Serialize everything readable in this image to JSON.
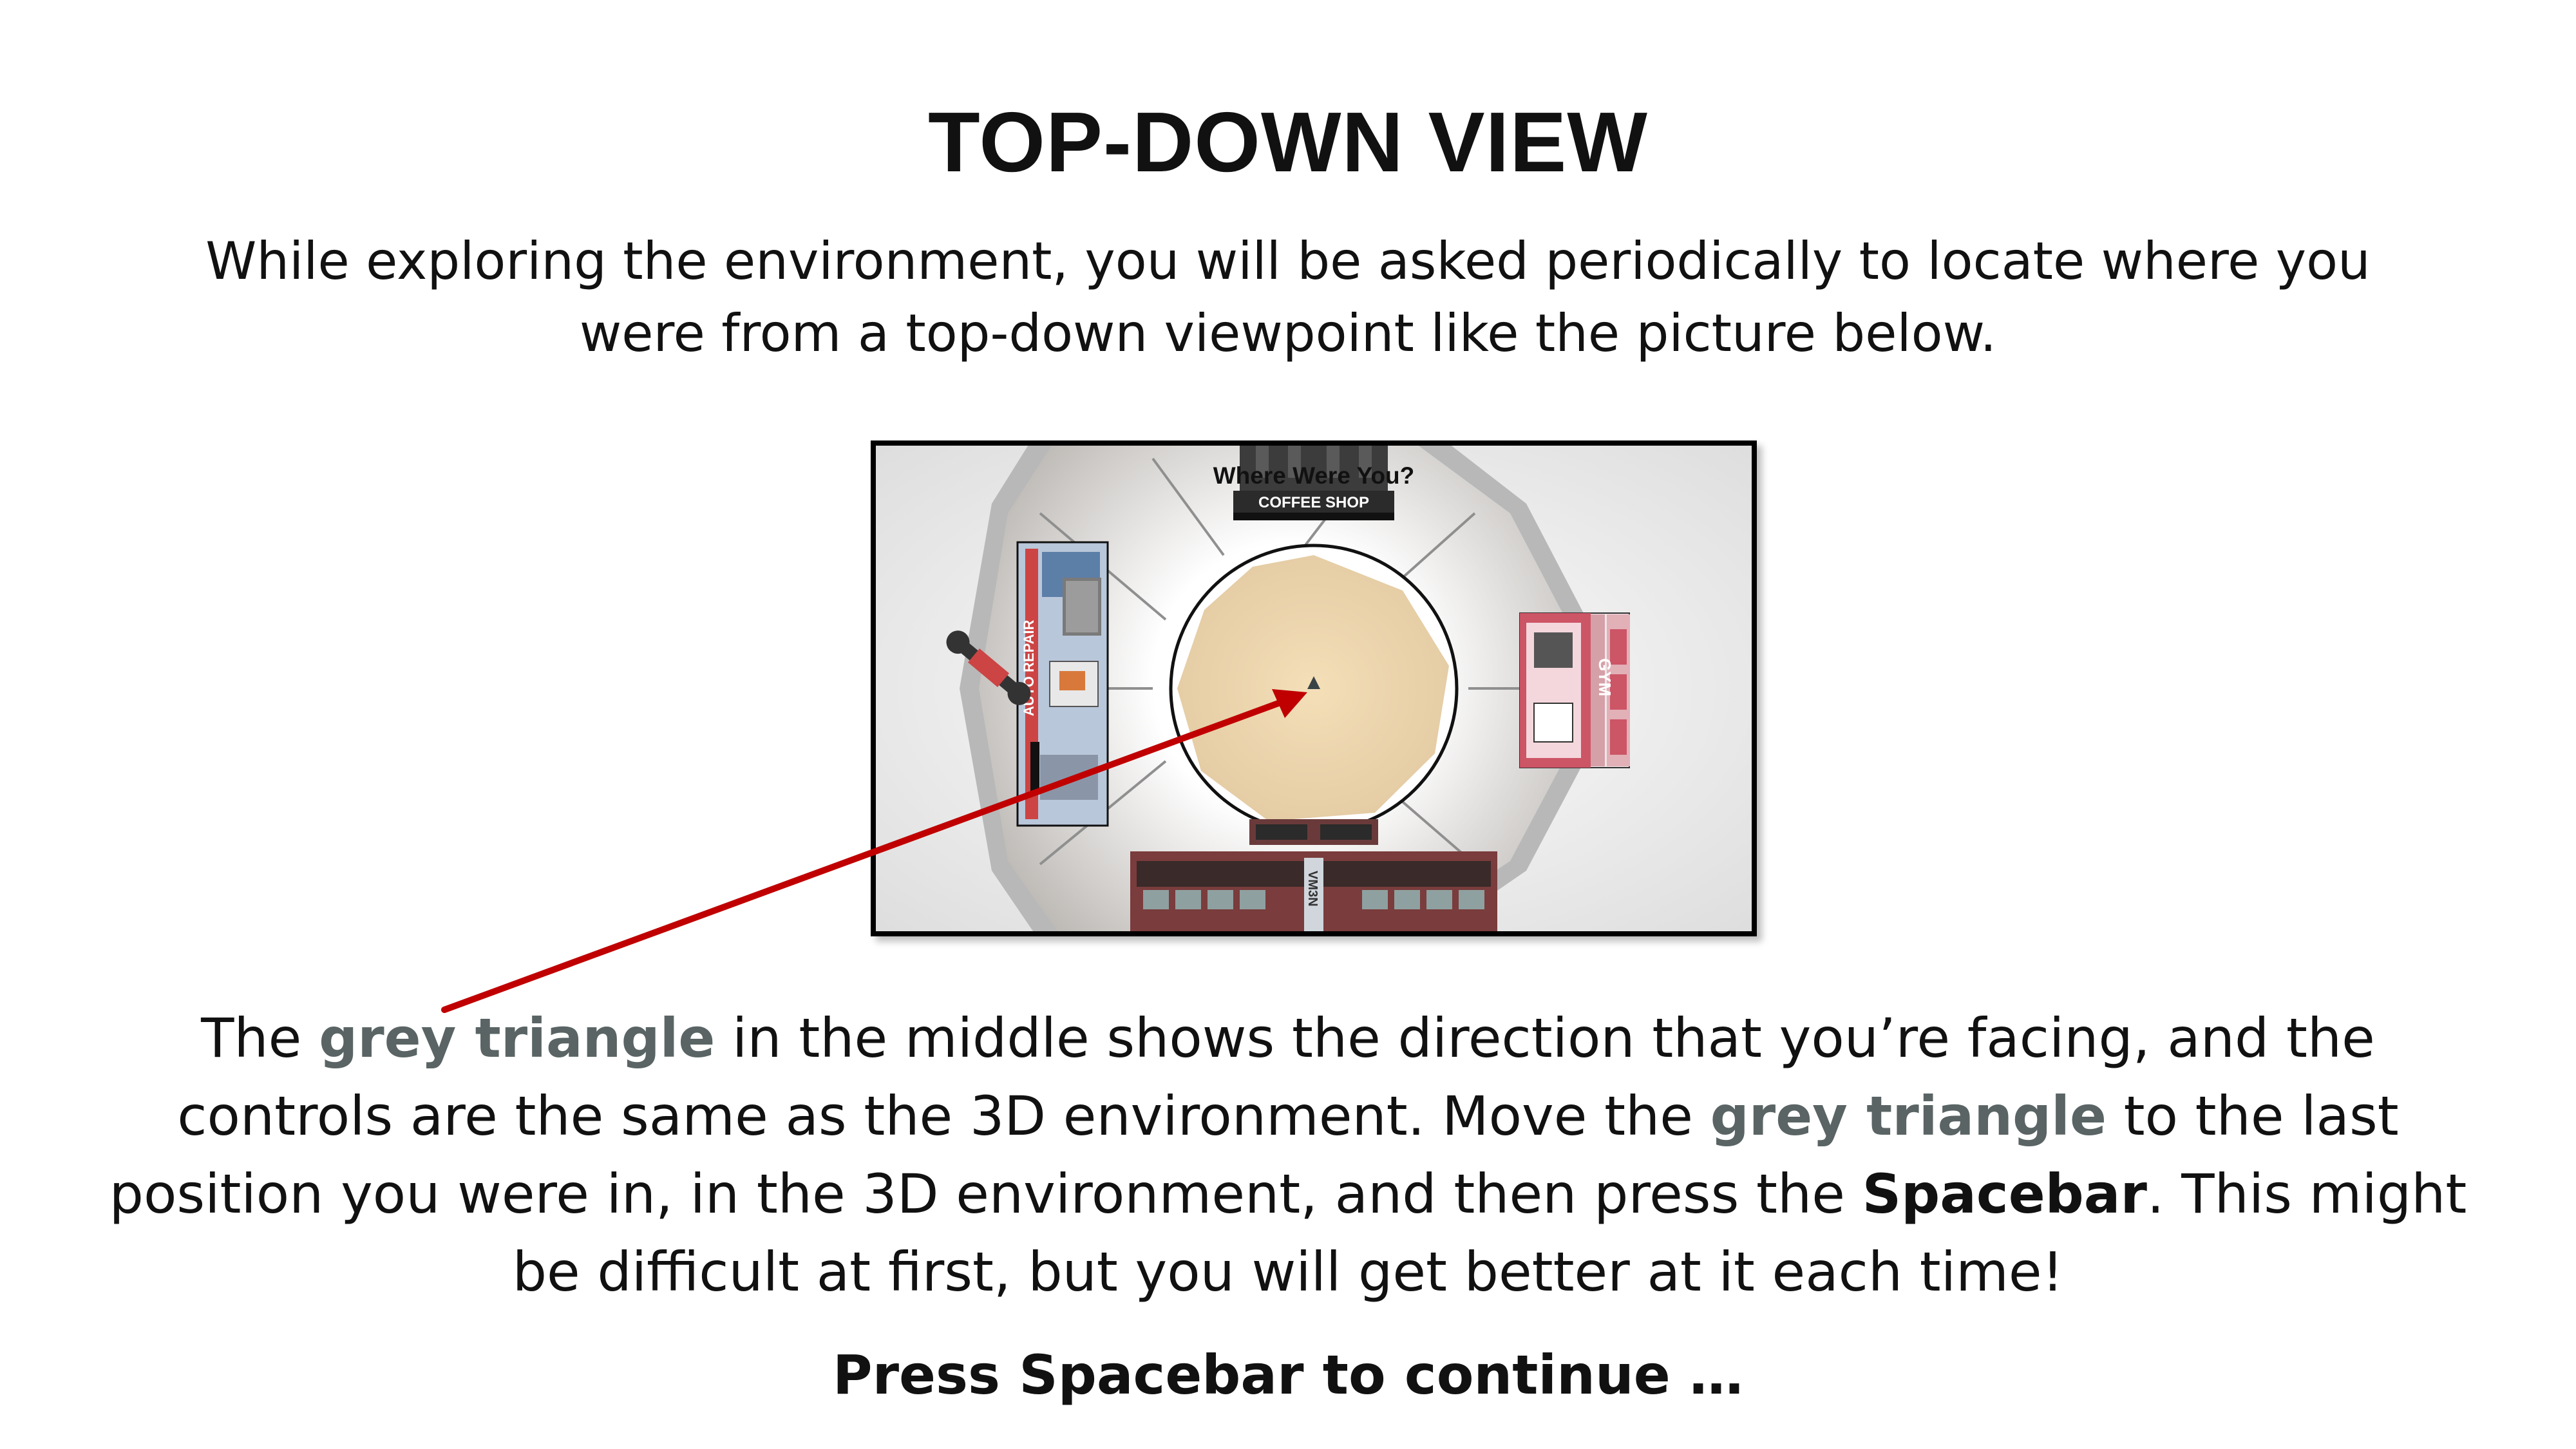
{
  "title": "TOP-DOWN VIEW",
  "intro": "While exploring the environment, you will be asked periodically to locate where you were from a top-down viewpoint like the picture below.",
  "map": {
    "heading": "Where Were You?",
    "signs": {
      "coffee_shop": "COFFEE SHOP",
      "auto_repair": "AUTO REPAIR",
      "gym": "GYM",
      "bottom_building": "VM3N"
    },
    "colors": {
      "plaza_floor": "#e2c9a1",
      "plaza_ring": "#c9c6c2",
      "gym_accent": "#cc5566",
      "auto_repair_accent": "#cc4444",
      "pointer_arrow": "#c00000"
    },
    "player_marker_icon": "grey-triangle-icon"
  },
  "body": {
    "s1_pre": "The ",
    "s1_hl": "grey triangle",
    "s1_post": " in the middle shows the direction that you’re facing, and the controls are the same as the 3D environment. Move the ",
    "s2_hl": "grey triangle",
    "s2_post": " to the last position you were in, in the 3D environment, and then press the ",
    "s3_bold": "Spacebar",
    "s3_post": ". This might be difficult at first, but you will get better at it each time!"
  },
  "continue": "Press Spacebar to continue …",
  "colors": {
    "highlight": "#5a6464"
  }
}
